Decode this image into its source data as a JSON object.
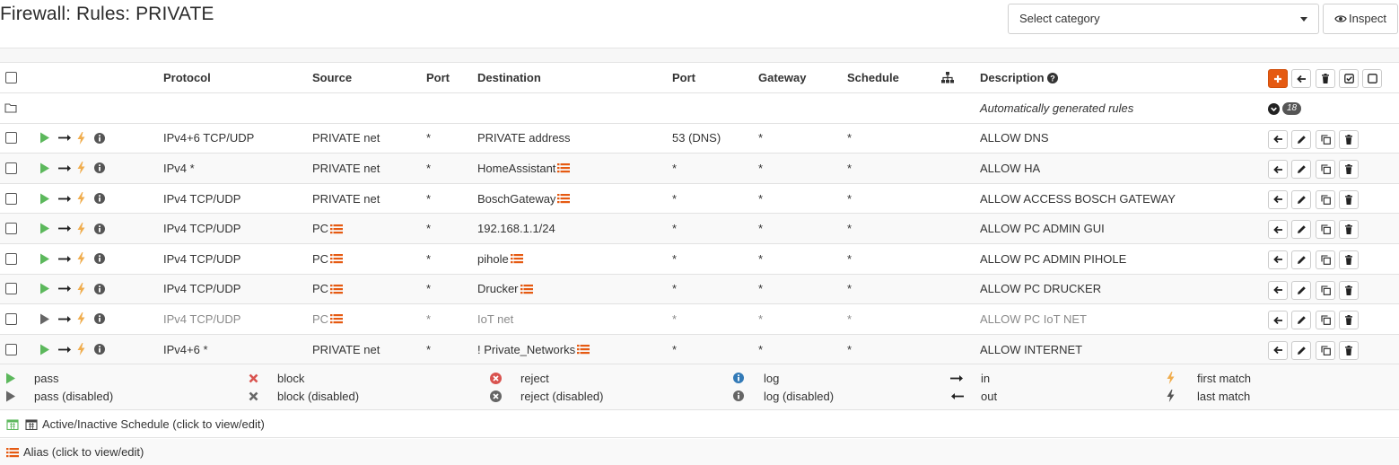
{
  "page": {
    "title": "Firewall: Rules: PRIVATE"
  },
  "toolbar": {
    "category_placeholder": "Select category",
    "inspect_label": "Inspect"
  },
  "table": {
    "headers": {
      "protocol": "Protocol",
      "source": "Source",
      "source_port": "Port",
      "destination": "Destination",
      "dest_port": "Port",
      "gateway": "Gateway",
      "schedule": "Schedule",
      "description": "Description"
    },
    "auto_group": {
      "description": "Automatically generated rules",
      "count": "18"
    },
    "rules": [
      {
        "protocol": "IPv4+6 TCP/UDP",
        "source": "PRIVATE net",
        "source_alias": false,
        "source_port": "*",
        "destination": "PRIVATE address",
        "dest_alias": false,
        "dest_port": "53 (DNS)",
        "gateway": "*",
        "schedule": "*",
        "description": "ALLOW DNS",
        "enabled": true
      },
      {
        "protocol": "IPv4 *",
        "source": "PRIVATE net",
        "source_alias": false,
        "source_port": "*",
        "destination": "HomeAssistant",
        "dest_alias": true,
        "dest_port": "*",
        "gateway": "*",
        "schedule": "*",
        "description": "ALLOW HA",
        "enabled": true
      },
      {
        "protocol": "IPv4 TCP/UDP",
        "source": "PRIVATE net",
        "source_alias": false,
        "source_port": "*",
        "destination": "BoschGateway",
        "dest_alias": true,
        "dest_port": "*",
        "gateway": "*",
        "schedule": "*",
        "description": "ALLOW ACCESS BOSCH GATEWAY",
        "enabled": true
      },
      {
        "protocol": "IPv4 TCP/UDP",
        "source": "PC",
        "source_alias": true,
        "source_port": "*",
        "destination": "192.168.1.1/24",
        "dest_alias": false,
        "dest_port": "*",
        "gateway": "*",
        "schedule": "*",
        "description": "ALLOW PC ADMIN GUI",
        "enabled": true
      },
      {
        "protocol": "IPv4 TCP/UDP",
        "source": "PC",
        "source_alias": true,
        "source_port": "*",
        "destination": "pihole",
        "dest_alias": true,
        "dest_port": "*",
        "gateway": "*",
        "schedule": "*",
        "description": "ALLOW PC ADMIN PIHOLE",
        "enabled": true
      },
      {
        "protocol": "IPv4 TCP/UDP",
        "source": "PC",
        "source_alias": true,
        "source_port": "*",
        "destination": "Drucker",
        "dest_alias": true,
        "dest_port": "*",
        "gateway": "*",
        "schedule": "*",
        "description": "ALLOW PC DRUCKER",
        "enabled": true
      },
      {
        "protocol": "IPv4 TCP/UDP",
        "source": "PC",
        "source_alias": true,
        "source_port": "*",
        "destination": "IoT net",
        "dest_alias": false,
        "dest_port": "*",
        "gateway": "*",
        "schedule": "*",
        "description": "ALLOW PC IoT NET",
        "enabled": false
      },
      {
        "protocol": "IPv4+6 *",
        "source": "PRIVATE net",
        "source_alias": false,
        "source_port": "*",
        "destination": "! Private_Networks",
        "dest_alias": true,
        "dest_port": "*",
        "gateway": "*",
        "schedule": "*",
        "description": "ALLOW INTERNET",
        "enabled": true
      }
    ]
  },
  "legend": {
    "pass": "pass",
    "pass_disabled": "pass (disabled)",
    "block": "block",
    "block_disabled": "block (disabled)",
    "reject": "reject",
    "reject_disabled": "reject (disabled)",
    "log": "log",
    "log_disabled": "log (disabled)",
    "in": "in",
    "out": "out",
    "first_match": "first match",
    "last_match": "last match"
  },
  "footer": {
    "schedule_note": "Active/Inactive Schedule (click to view/edit)",
    "alias_note": "Alias (click to view/edit)"
  },
  "colors": {
    "accent": "#e55a12",
    "pass": "#5cb85c",
    "block": "#d9534f",
    "alias": "#e55a12",
    "first_match": "#f0ad4e"
  },
  "icons": [
    "eye-icon",
    "chevron-down-icon",
    "play-icon",
    "arrow-right-icon",
    "bolt-icon",
    "info-icon",
    "alias-list-icon",
    "folder-icon",
    "sitemap-icon",
    "question-icon",
    "plus-icon",
    "arrow-left-icon",
    "trash-icon",
    "check-square-icon",
    "square-icon",
    "pencil-icon",
    "copy-icon",
    "calendar-icon"
  ]
}
